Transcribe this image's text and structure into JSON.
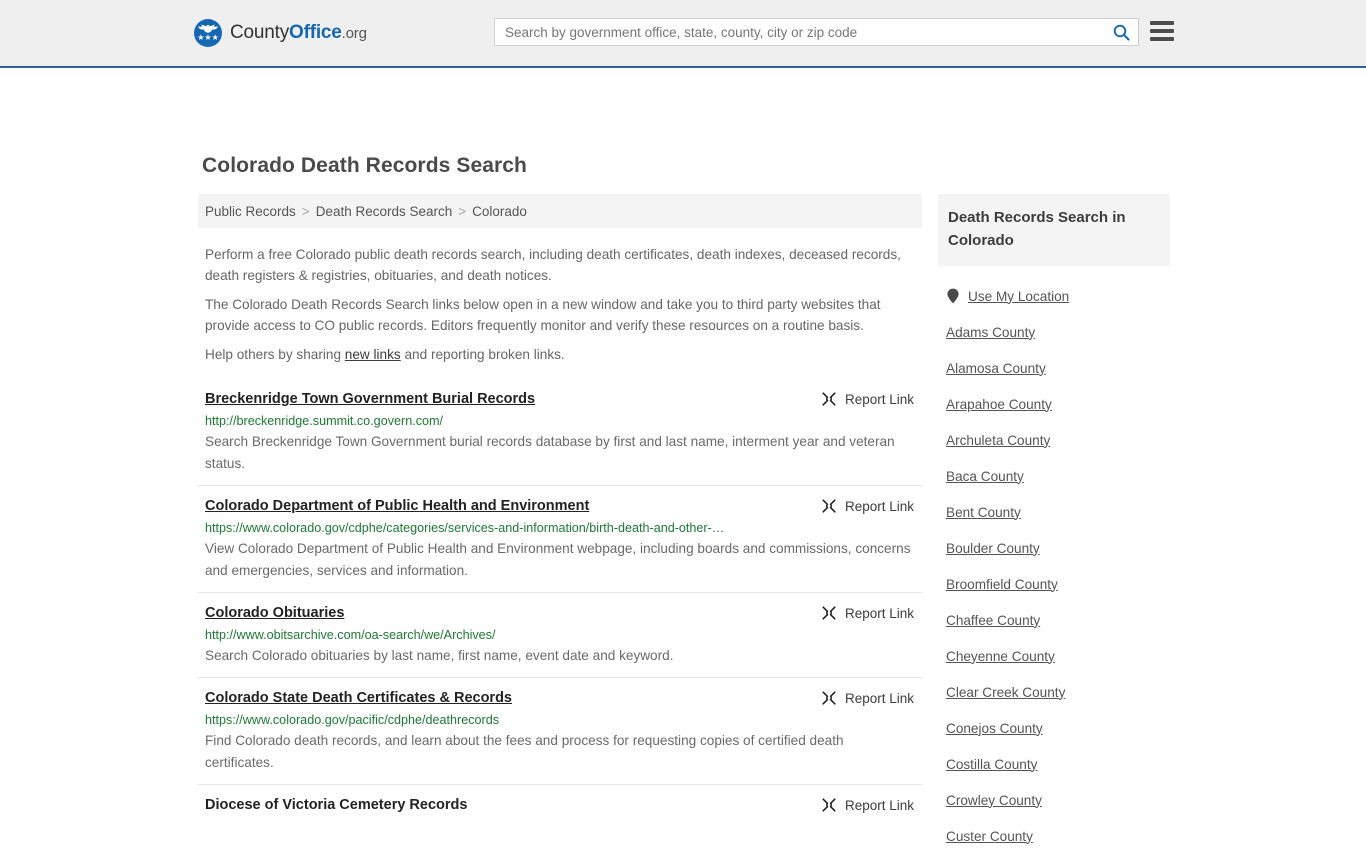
{
  "header": {
    "brand": {
      "part1": "County",
      "part2": "Office",
      "part3": ".org",
      "logo_icon": "eagle-stars-seal-icon"
    },
    "search": {
      "placeholder": "Search by government office, state, county, city or zip code",
      "value": "",
      "search_icon": "search-icon"
    },
    "menu_icon": "hamburger-menu-icon",
    "accent_color": "#1667b2"
  },
  "page_title": "Colorado Death Records Search",
  "breadcrumb": {
    "items": [
      {
        "label": "Public Records",
        "current": false
      },
      {
        "label": "Death Records Search",
        "current": false
      },
      {
        "label": "Colorado",
        "current": true
      }
    ],
    "separator": ">"
  },
  "intro": {
    "paragraph1": "Perform a free Colorado public death records search, including death certificates, death indexes, deceased records, death registers & registries, obituaries, and death notices.",
    "paragraph2": "The Colorado Death Records Search links below open in a new window and take you to third party websites that provide access to CO public records. Editors frequently monitor and verify these resources on a routine basis.",
    "paragraph3_before": "Help others by sharing ",
    "paragraph3_link": "new links",
    "paragraph3_after": " and reporting broken links."
  },
  "report_link": {
    "label": "Report Link",
    "icon": "broken-link-icon"
  },
  "results": [
    {
      "title": "Breckenridge Town Government Burial Records",
      "url": "http://breckenridge.summit.co.govern.com/",
      "description": "Search Breckenridge Town Government burial records database by first and last name, interment year and veteran status."
    },
    {
      "title": "Colorado Department of Public Health and Environment",
      "url": "https://www.colorado.gov/cdphe/categories/services-and-information/birth-death-and-other-…",
      "description": "View Colorado Department of Public Health and Environment webpage, including boards and commissions, concerns and emergencies, services and information."
    },
    {
      "title": "Colorado Obituaries",
      "url": "http://www.obitsarchive.com/oa-search/we/Archives/",
      "description": "Search Colorado obituaries by last name, first name, event date and keyword."
    },
    {
      "title": "Colorado State Death Certificates & Records",
      "url": "https://www.colorado.gov/pacific/cdphe/deathrecords",
      "description": "Find Colorado death records, and learn about the fees and process for requesting copies of certified death certificates."
    },
    {
      "title": "Diocese of Victoria Cemetery Records",
      "url": "",
      "description": ""
    }
  ],
  "sidebar": {
    "title": "Death Records Search in Colorado",
    "use_my_location": {
      "label": "Use My Location",
      "icon": "map-pin-icon"
    },
    "counties": [
      {
        "label": "Adams County"
      },
      {
        "label": "Alamosa County"
      },
      {
        "label": "Arapahoe County"
      },
      {
        "label": "Archuleta County"
      },
      {
        "label": "Baca County"
      },
      {
        "label": "Bent County"
      },
      {
        "label": "Boulder County"
      },
      {
        "label": "Broomfield County"
      },
      {
        "label": "Chaffee County"
      },
      {
        "label": "Cheyenne County"
      },
      {
        "label": "Clear Creek County"
      },
      {
        "label": "Conejos County"
      },
      {
        "label": "Costilla County"
      },
      {
        "label": "Crowley County"
      },
      {
        "label": "Custer County"
      }
    ]
  },
  "colors": {
    "header_bg": "#efefef",
    "header_border": "#2a6496",
    "url_green": "#1d7a33",
    "panel_gray": "#f4f4f4"
  }
}
